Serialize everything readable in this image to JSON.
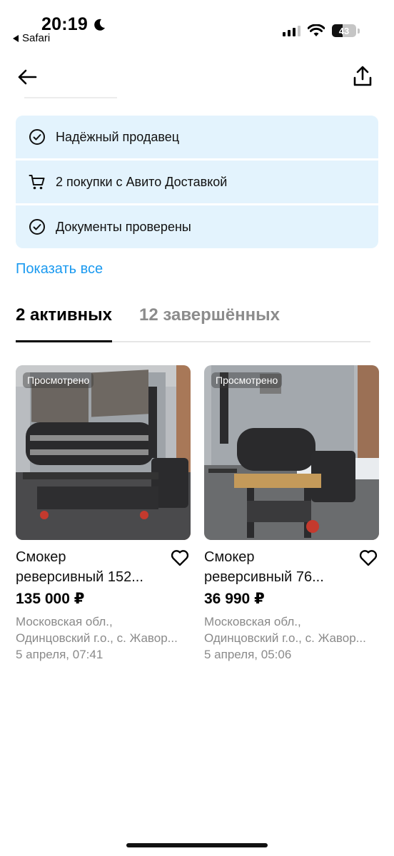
{
  "status_bar": {
    "time": "20:19",
    "back_app": "Safari",
    "battery": "43",
    "battery_level": 0.43
  },
  "info_items": [
    {
      "label": "Надёжный продавец",
      "icon": "check-circle-icon"
    },
    {
      "label": "2 покупки с Авито Доставкой",
      "icon": "cart-icon"
    },
    {
      "label": "Документы проверены",
      "icon": "check-circle-icon"
    }
  ],
  "show_all": "Показать все",
  "tabs": {
    "active": "2 активных",
    "inactive": "12 завершённых"
  },
  "listings": [
    {
      "badge": "Просмотрено",
      "title_line1": "Смокер",
      "title_line2": "реверсивный 152...",
      "price": "135 000 ₽",
      "location_line1": "Московская обл.,",
      "location_line2": "Одинцовский г.о., с. Жавор...",
      "date": "5 апреля, 07:41"
    },
    {
      "badge": "Просмотрено",
      "title_line1": "Смокер",
      "title_line2": "реверсивный 76...",
      "price": "36 990 ₽",
      "location_line1": "Московская обл.,",
      "location_line2": "Одинцовский г.о., с. Жавор...",
      "date": "5 апреля, 05:06"
    }
  ],
  "colors": {
    "accent_link": "#1b9af0",
    "info_bg": "#e3f3fd"
  }
}
